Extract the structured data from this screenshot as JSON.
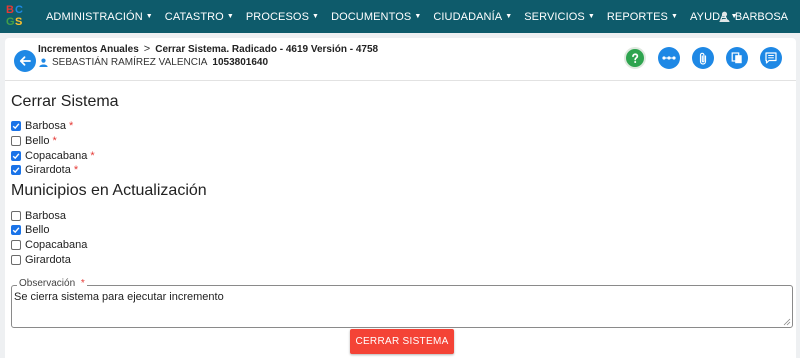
{
  "colors": {
    "navbar": "#0e5b6b",
    "primary": "#1e88e5",
    "help": "#2ea44f",
    "danger": "#f44336",
    "checkbox": "#1a73e8",
    "required": "#e53935"
  },
  "logo": {
    "letters": [
      "B",
      "C",
      "G",
      "S"
    ],
    "letter_colors": [
      "#e53935",
      "#1e88e5",
      "#43a047",
      "#fbc02d"
    ]
  },
  "nav": {
    "items": [
      {
        "label": "ADMINISTRACIÓN"
      },
      {
        "label": "CATASTRO"
      },
      {
        "label": "PROCESOS"
      },
      {
        "label": "DOCUMENTOS"
      },
      {
        "label": "CIUDADANÍA"
      },
      {
        "label": "SERVICIOS"
      },
      {
        "label": "REPORTES"
      },
      {
        "label": "AYUDA"
      }
    ],
    "caret": "▼",
    "user": "BARBOSA"
  },
  "header": {
    "breadcrumb_parent": "Incrementos Anuales",
    "breadcrumb_sep": ">",
    "breadcrumb_current": "Cerrar Sistema. Radicado - 4619 Versión - 4758",
    "person_name": "SEBASTIÁN RAMÍREZ VALENCIA",
    "person_doc": "1053801640",
    "icons": [
      "back-arrow-icon",
      "help-icon",
      "more-horizontal-icon",
      "attach-icon",
      "copy-icon",
      "notes-icon"
    ]
  },
  "cerrar": {
    "title": "Cerrar Sistema",
    "items": [
      {
        "label": "Barbosa",
        "checked": true,
        "required": "*"
      },
      {
        "label": "Bello",
        "checked": false,
        "required": "*"
      },
      {
        "label": "Copacabana",
        "checked": true,
        "required": "*"
      },
      {
        "label": "Girardota",
        "checked": true,
        "required": "*"
      }
    ]
  },
  "municipios": {
    "title": "Municipios en Actualización",
    "items": [
      {
        "label": "Barbosa",
        "checked": false
      },
      {
        "label": "Bello",
        "checked": true
      },
      {
        "label": "Copacabana",
        "checked": false
      },
      {
        "label": "Girardota",
        "checked": false
      }
    ]
  },
  "observacion": {
    "label": "Observación",
    "required": "*",
    "value": "Se cierra sistema para ejecutar incremento"
  },
  "submit": {
    "label": "CERRAR SISTEMA"
  }
}
